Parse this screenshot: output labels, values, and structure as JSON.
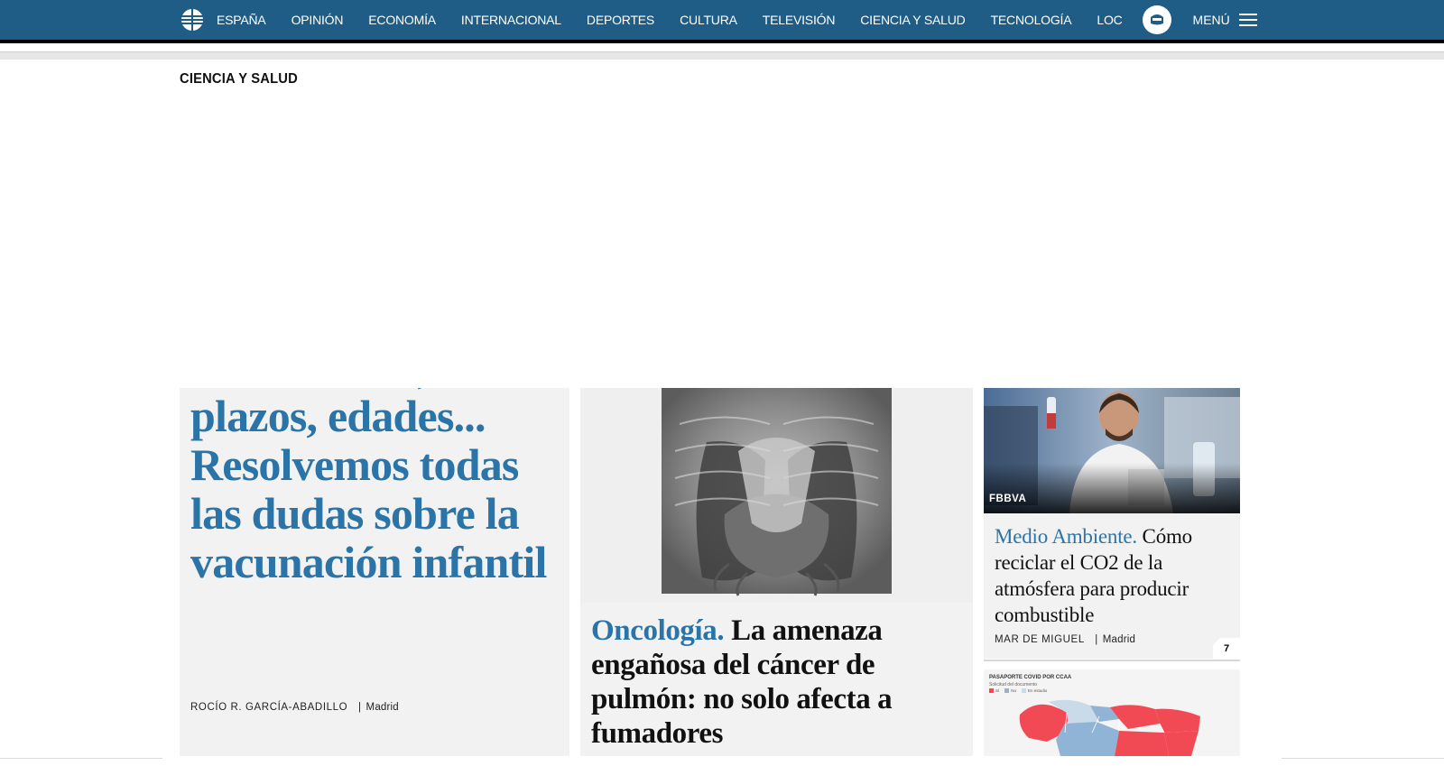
{
  "nav": {
    "items": [
      "ESPAÑA",
      "OPINIÓN",
      "ECONOMÍA",
      "INTERNACIONAL",
      "DEPORTES",
      "CULTURA",
      "TELEVISIÓN",
      "CIENCIA Y SALUD",
      "TECNOLOGÍA",
      "LOC"
    ],
    "menu_label": "MENÚ"
  },
  "section_title": "CIENCIA Y SALUD",
  "lead_story": {
    "headline": "Salud. Dosis, plazos, edades... Resolvemos todas las dudas sobre la vacunación infantil",
    "author": "ROCÍO R. GARCÍA-ABADILLO",
    "location": "Madrid"
  },
  "second_story": {
    "kicker": "Oncología.",
    "headline": "La amenaza engañosa del cáncer de pulmón: no solo afecta a fumadores"
  },
  "third_story": {
    "photo_credit": "FBBVA",
    "kicker": "Medio Ambiente.",
    "headline": "Cómo reciclar el CO2 de la atmósfera para producir combustible",
    "author": "MAR DE MIGUEL",
    "location": "Madrid",
    "comment_count": "7"
  },
  "map_card": {
    "title": "PASAPORTE COVID POR CCAA",
    "subtitle": "Solicitud del documento",
    "legend": [
      "Sí",
      "No",
      "En estudio"
    ]
  },
  "colors": {
    "nav_bg": "#1f5d86",
    "accent": "#2b74a7",
    "map_red": "#f24a55",
    "map_blue": "#8fb4d6"
  }
}
